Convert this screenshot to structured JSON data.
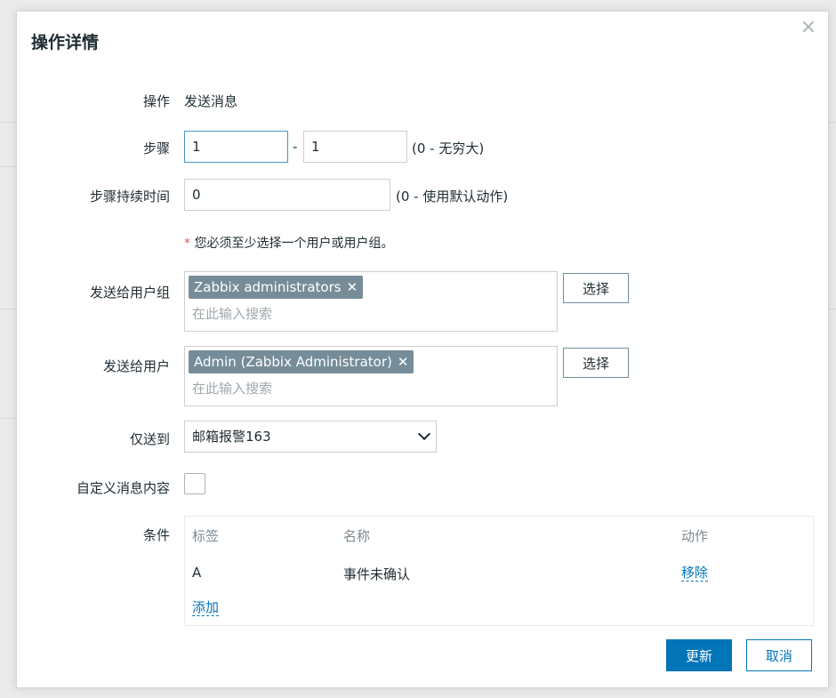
{
  "dialog": {
    "title": "操作详情",
    "close_symbol": "×"
  },
  "form": {
    "operation": {
      "label": "操作",
      "value": "发送消息"
    },
    "steps": {
      "label": "步骤",
      "from": "1",
      "separator": "-",
      "to": "1",
      "hint": "(0 - 无穷大)"
    },
    "step_duration": {
      "label": "步骤持续时间",
      "value": "0",
      "hint": "(0 - 使用默认动作)"
    },
    "requirement": {
      "asterisk": "*",
      "text": "您必须至少选择一个用户或用户组。"
    },
    "send_to_groups": {
      "label": "发送给用户组",
      "tag": "Zabbix administrators",
      "placeholder": "在此输入搜索",
      "select_label": "选择"
    },
    "send_to_users": {
      "label": "发送给用户",
      "tag": "Admin (Zabbix Administrator)",
      "placeholder": "在此输入搜索",
      "select_label": "选择"
    },
    "send_only_to": {
      "label": "仅送到",
      "selected": "邮箱报警163"
    },
    "custom_message": {
      "label": "自定义消息内容",
      "checked": false
    },
    "conditions": {
      "label": "条件",
      "headers": [
        "标签",
        "名称",
        "动作"
      ],
      "rows": [
        {
          "label": "A",
          "name": "事件未确认",
          "action": "移除"
        }
      ],
      "add_label": "添加"
    }
  },
  "footer": {
    "update_label": "更新",
    "cancel_label": "取消"
  },
  "icons": {
    "tag_remove": "✕"
  },
  "colors": {
    "primary": "#0275b8",
    "tag_bg": "#768d99",
    "required": "#e45959"
  }
}
